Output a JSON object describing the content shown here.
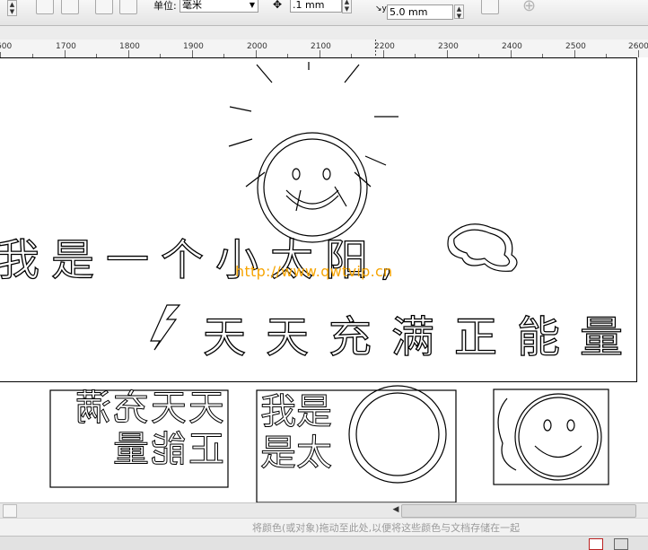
{
  "toolbar": {
    "unit_label": "单位:",
    "unit_value": "毫米",
    "nudge_value": ".1 mm",
    "dup_x_value": "5.0 mm",
    "dup_y_value": "5.0 mm",
    "icons": [
      "portrait-icon",
      "landscape-icon",
      "all-pages-icon",
      "current-page-icon",
      "nudge-icon",
      "duplicate-distance-icon",
      "treat-as-filled-icon",
      "add-page-icon"
    ]
  },
  "ruler": {
    "labels": [
      "600",
      "1700",
      "1800",
      "1900",
      "2000",
      "2100",
      "2200",
      "2300",
      "2400",
      "2500",
      "2600"
    ]
  },
  "artwork": {
    "line1_text": "我是一个小太阳,",
    "line2_text": "天天充满正能量",
    "watermark": "http://www.qwtvip.cn"
  },
  "status": {
    "hint": "将颜色(或对象)拖动至此处,以便将这些颜色与文档存储在一起"
  },
  "colors": {
    "watermark": "#f6a400",
    "canvas": "#ffffff",
    "chrome": "#ececec"
  }
}
